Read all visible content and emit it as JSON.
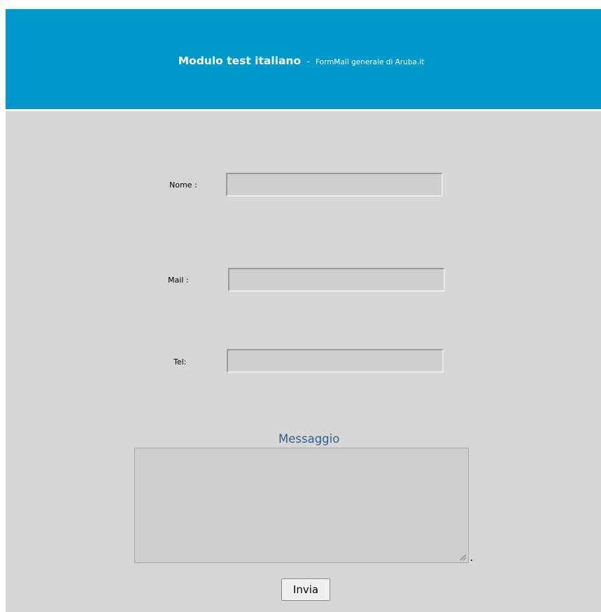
{
  "header": {
    "title": "Modulo test italiano",
    "separator": "-",
    "subtitle": "FormMail generale di Aruba.it"
  },
  "form": {
    "nome_label": "Nome :",
    "nome_value": "",
    "mail_label": "Mail :",
    "mail_value": "",
    "tel_label": "Tel:",
    "tel_value": "",
    "message_label": "Messaggio",
    "message_value": "",
    "submit_label": "Invia"
  },
  "colors": {
    "header_bg": "#0099cc",
    "form_bg": "#d6d6d6",
    "field_bg": "#cecece",
    "message_label": "#2e5f8a"
  }
}
